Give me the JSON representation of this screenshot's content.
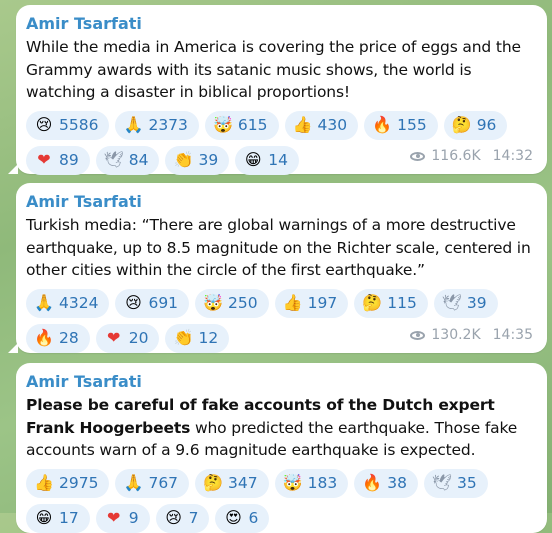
{
  "messages": [
    {
      "sender": "Amir Tsarfati",
      "text": "While the media in America is covering the price of eggs and the Grammy awards with its satanic music shows, the world is watching a disaster in biblical proportions!",
      "reactions": [
        {
          "icon": "crying-face-icon",
          "glyph": "😢",
          "count": "5586"
        },
        {
          "icon": "praying-hands-icon",
          "glyph": "🙏",
          "count": "2373"
        },
        {
          "icon": "exploding-head-icon",
          "glyph": "🤯",
          "count": "615"
        },
        {
          "icon": "thumbs-up-icon",
          "glyph": "👍",
          "count": "430"
        },
        {
          "icon": "fire-icon",
          "glyph": "🔥",
          "count": "155"
        },
        {
          "icon": "thinking-face-icon",
          "glyph": "🤔",
          "count": "96"
        },
        {
          "icon": "red-heart-icon",
          "glyph": "❤",
          "count": "89"
        },
        {
          "icon": "dove-icon",
          "glyph": "🕊",
          "count": "84"
        },
        {
          "icon": "clapping-hands-icon",
          "glyph": "👏",
          "count": "39"
        },
        {
          "icon": "grinning-face-icon",
          "glyph": "😁",
          "count": "14"
        }
      ],
      "views": "116.6K",
      "time": "14:32"
    },
    {
      "sender": "Amir Tsarfati",
      "text": "Turkish media: “There are global warnings of a more destructive earthquake, up to 8.5 magnitude on the Richter scale, centered in other cities within the circle of the first earthquake.”",
      "reactions": [
        {
          "icon": "praying-hands-icon",
          "glyph": "🙏",
          "count": "4324"
        },
        {
          "icon": "crying-face-icon",
          "glyph": "😢",
          "count": "691"
        },
        {
          "icon": "exploding-head-icon",
          "glyph": "🤯",
          "count": "250"
        },
        {
          "icon": "thumbs-up-icon",
          "glyph": "👍",
          "count": "197"
        },
        {
          "icon": "thinking-face-icon",
          "glyph": "🤔",
          "count": "115"
        },
        {
          "icon": "dove-icon",
          "glyph": "🕊",
          "count": "39"
        },
        {
          "icon": "fire-icon",
          "glyph": "🔥",
          "count": "28"
        },
        {
          "icon": "red-heart-icon",
          "glyph": "❤",
          "count": "20"
        },
        {
          "icon": "clapping-hands-icon",
          "glyph": "👏",
          "count": "12"
        }
      ],
      "views": "130.2K",
      "time": "14:35"
    },
    {
      "sender": "Amir Tsarfati",
      "text_bold": "Please be careful of fake accounts of the Dutch expert Frank Hoogerbeets",
      "text": " who predicted the earthquake. Those fake accounts warn of a 9.6 magnitude earthquake is expected.",
      "reactions": [
        {
          "icon": "thumbs-up-icon",
          "glyph": "👍",
          "count": "2975"
        },
        {
          "icon": "praying-hands-icon",
          "glyph": "🙏",
          "count": "767"
        },
        {
          "icon": "thinking-face-icon",
          "glyph": "🤔",
          "count": "347"
        },
        {
          "icon": "exploding-head-icon",
          "glyph": "🤯",
          "count": "183"
        },
        {
          "icon": "fire-icon",
          "glyph": "🔥",
          "count": "38"
        },
        {
          "icon": "dove-icon",
          "glyph": "🕊",
          "count": "35"
        },
        {
          "icon": "grinning-face-icon",
          "glyph": "😁",
          "count": "17"
        },
        {
          "icon": "red-heart-icon",
          "glyph": "❤",
          "count": "9"
        },
        {
          "icon": "crying-face-icon",
          "glyph": "😢",
          "count": "7"
        },
        {
          "icon": "heart-eyes-icon",
          "glyph": "😍",
          "count": "6"
        }
      ]
    }
  ],
  "colors": {
    "sender": "#3a8dc8",
    "chip_bg": "#e7f1fb",
    "chip_text": "#2f74b5",
    "meta": "#9aa3ad",
    "heart": "#e53935"
  }
}
